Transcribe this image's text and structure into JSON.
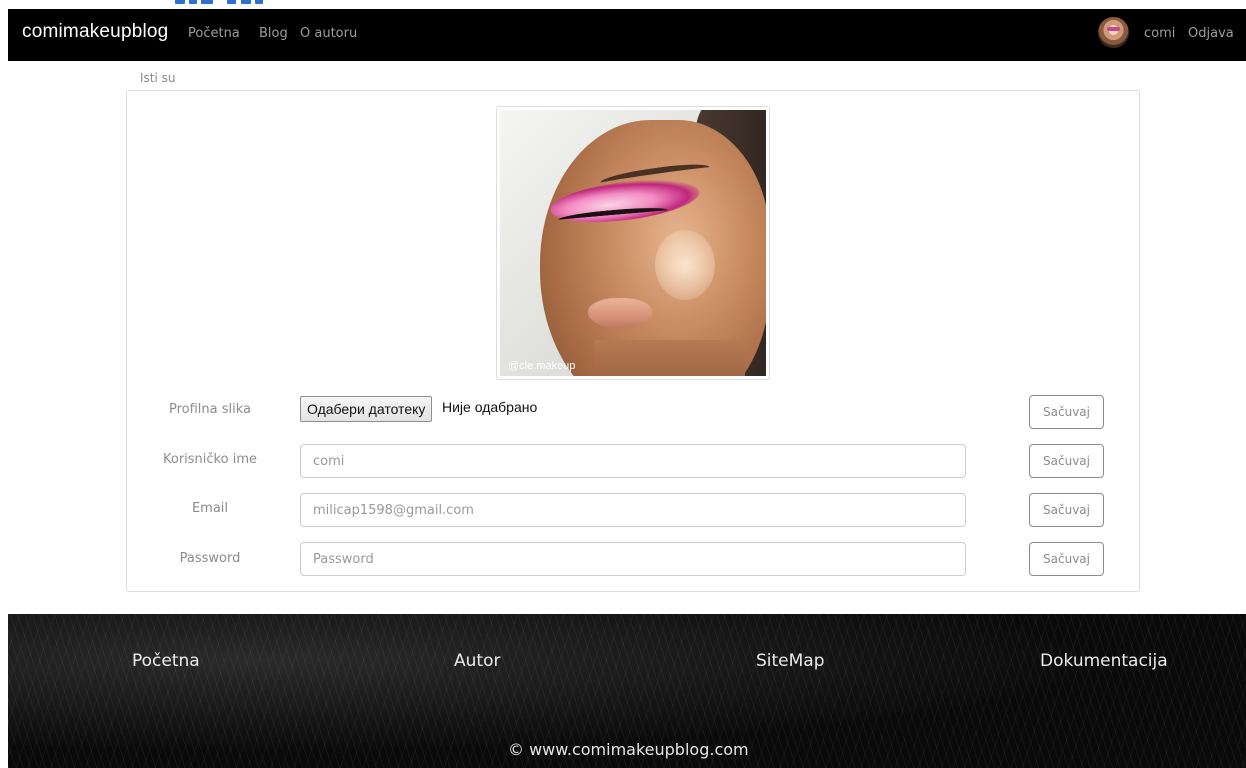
{
  "navbar": {
    "brand": "comimakeupblog",
    "links": [
      "Početna",
      "Blog",
      "O autoru"
    ],
    "username": "comi",
    "logout": "Odjava"
  },
  "breadcrumb": "Isti su",
  "profile_image": {
    "watermark": "@cle.makeup"
  },
  "form": {
    "rows": [
      {
        "label": "Profilna slika",
        "button": "Одабери датотеку",
        "status": "Није одабрано",
        "save": "Sačuvaj"
      },
      {
        "label": "Korisničko ime",
        "value": "comi",
        "save": "Sačuvaj"
      },
      {
        "label": "Email",
        "value": "milicap1598@gmail.com",
        "save": "Sačuvaj"
      },
      {
        "label": "Password",
        "placeholder": "Password",
        "save": "Sačuvaj"
      }
    ]
  },
  "footer": {
    "links": [
      "Početna",
      "Autor",
      "SiteMap",
      "Dokumentacija"
    ],
    "copyright": "© www.comimakeupblog.com"
  },
  "colors": {
    "navbar_bg": "#000000",
    "panel_border": "#dddddd",
    "muted_text": "#8c8c8c"
  }
}
